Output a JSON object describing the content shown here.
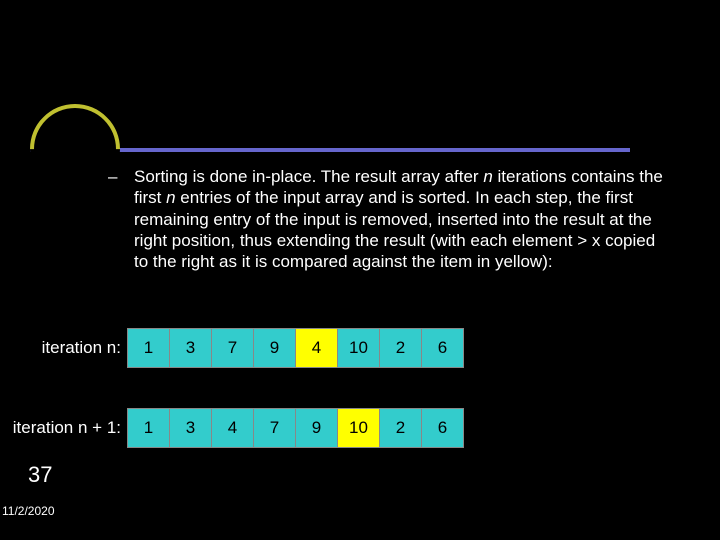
{
  "bullet_dash": "–",
  "main_text_parts": {
    "p1": "Sorting is done in-place. The result array after ",
    "n1": "n",
    "p2": " iterations contains the first ",
    "n2": "n",
    "p3": " entries of the input array and is sorted. In each step, the first remaining entry of the input is removed, inserted into the result at the right position, thus extending the result (with each element > x copied to the right as it is compared against the item in yellow):"
  },
  "rows": [
    {
      "label": "iteration n:",
      "cells": [
        {
          "v": "1",
          "cls": "sorted"
        },
        {
          "v": "3",
          "cls": "sorted"
        },
        {
          "v": "7",
          "cls": "sorted"
        },
        {
          "v": "9",
          "cls": "sorted"
        },
        {
          "v": "4",
          "cls": "current"
        },
        {
          "v": "10",
          "cls": "unsorted"
        },
        {
          "v": "2",
          "cls": "unsorted"
        },
        {
          "v": "6",
          "cls": "unsorted"
        }
      ]
    },
    {
      "label": "iteration n + 1:",
      "cells": [
        {
          "v": "1",
          "cls": "sorted"
        },
        {
          "v": "3",
          "cls": "sorted"
        },
        {
          "v": "4",
          "cls": "sorted"
        },
        {
          "v": "7",
          "cls": "sorted"
        },
        {
          "v": "9",
          "cls": "sorted"
        },
        {
          "v": "10",
          "cls": "current"
        },
        {
          "v": "2",
          "cls": "unsorted"
        },
        {
          "v": "6",
          "cls": "unsorted"
        }
      ]
    }
  ],
  "slide_number": "37",
  "date": "11/2/2020"
}
